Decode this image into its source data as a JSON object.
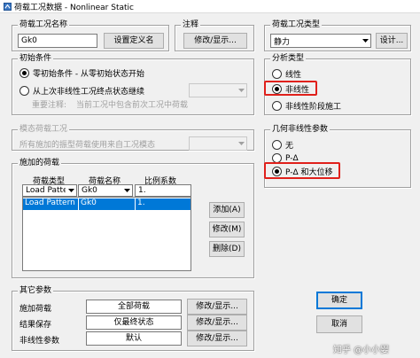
{
  "window": {
    "title": "荷载工况数据 - Nonlinear Static"
  },
  "case_name": {
    "legend": "荷载工况名称",
    "value": "Gk0",
    "set_def_button": "设置定义名"
  },
  "notes": {
    "legend": "注释",
    "button": "修改/显示..."
  },
  "case_type": {
    "legend": "荷载工况类型",
    "value": "静力",
    "button": "设计..."
  },
  "initial": {
    "legend": "初始条件",
    "opt1": "零初始条件 - 从零初始状态开始",
    "opt2": "从上次非线性工况终点状态继续",
    "note_label": "重要注释:",
    "note_text": "当前工况中包含前次工况中荷载"
  },
  "analysis_type": {
    "legend": "分析类型",
    "opt1": "线性",
    "opt2": "非线性",
    "opt3": "非线性阶段施工"
  },
  "modal": {
    "legend": "模态荷载工况",
    "text": "所有施加的振型荷载使用来自工况模态"
  },
  "geometric": {
    "legend": "几何非线性参数",
    "opt1": "无",
    "opt2": "P-Δ",
    "opt3": "P-Δ 和大位移"
  },
  "loads": {
    "legend": "施加的荷载",
    "headers": [
      "荷载类型",
      "荷载名称",
      "比例系数"
    ],
    "input_row": [
      "Load Pattern",
      "Gk0",
      "1."
    ],
    "rows": [
      [
        "Load Pattern",
        "Gk0",
        "1."
      ]
    ],
    "add_button": "添加(A)",
    "modify_button": "修改(M)",
    "delete_button": "删除(D)"
  },
  "other": {
    "legend": "其它参数",
    "rows": [
      {
        "label": "施加荷载",
        "value": "全部荷载",
        "button": "修改/显示..."
      },
      {
        "label": "结果保存",
        "value": "仅最终状态",
        "button": "修改/显示..."
      },
      {
        "label": "非线性参数",
        "value": "默认",
        "button": "修改/显示..."
      }
    ]
  },
  "dialog": {
    "ok": "确定",
    "cancel": "取消"
  },
  "watermark": "知乎 @小小婴"
}
